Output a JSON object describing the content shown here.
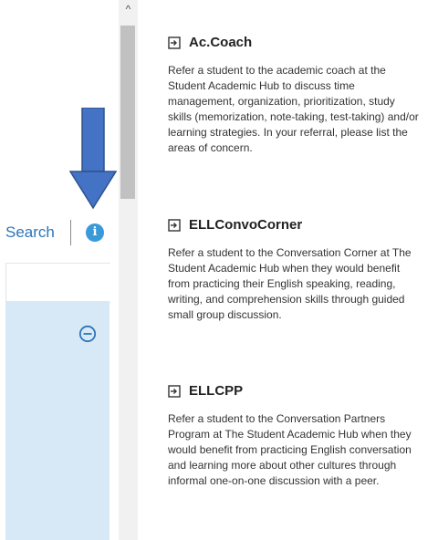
{
  "left": {
    "search_link": "Search",
    "info_icon": "info-icon",
    "arrow_icon": "down-arrow-icon",
    "collapse_icon": "minus-circle-icon",
    "accent_color": "#2e75b6",
    "arrow_color": "#4472c4",
    "panel_color": "#d7e9f7"
  },
  "scrollbar": {
    "up_glyph": "^"
  },
  "items": [
    {
      "title": "Ac.Coach",
      "icon": "sign-in-icon",
      "description": "Refer a student to the academic coach at the Student Academic Hub to discuss time management, organization, prioritization, study skills (memorization, note-taking, test-taking) and/or learning strategies. In your referral, please list the areas of concern."
    },
    {
      "title": "ELLConvoCorner",
      "icon": "sign-in-icon",
      "description": "Refer a student to the Conversation Corner at The Student Academic Hub when they would benefit from practicing their English speaking, reading, writing, and comprehension skills through guided small group discussion."
    },
    {
      "title": "ELLCPP",
      "icon": "sign-in-icon",
      "description": "Refer a student to the Conversation Partners Program at The Student Academic Hub when they would benefit from practicing English conversation and learning more about other cultures through informal one-on-one discussion with a peer."
    }
  ]
}
